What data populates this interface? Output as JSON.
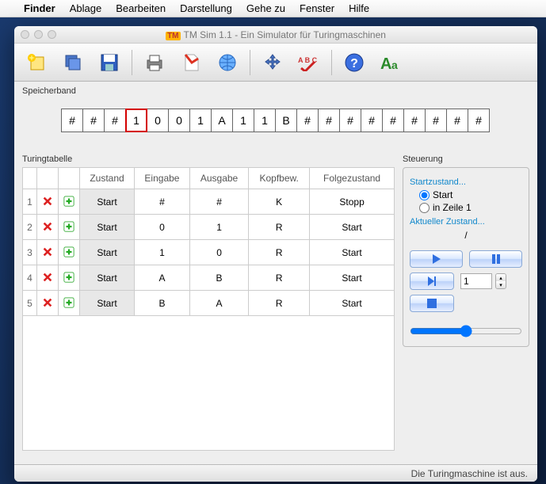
{
  "menubar": {
    "items": [
      "Finder",
      "Ablage",
      "Bearbeiten",
      "Darstellung",
      "Gehe zu",
      "Fenster",
      "Hilfe"
    ]
  },
  "window": {
    "title": "TM Sim 1.1 - Ein Simulator für Turingmaschinen",
    "badge": "TM"
  },
  "sections": {
    "tape": "Speicherband",
    "table": "Turingtabelle",
    "control": "Steuerung"
  },
  "tape": {
    "cells": [
      "#",
      "#",
      "#",
      "1",
      "0",
      "0",
      "1",
      "A",
      "1",
      "1",
      "B",
      "#",
      "#",
      "#",
      "#",
      "#",
      "#",
      "#",
      "#",
      "#"
    ],
    "head": 3
  },
  "table": {
    "headers": [
      "Zustand",
      "Eingabe",
      "Ausgabe",
      "Kopfbew.",
      "Folgezustand"
    ],
    "rows": [
      {
        "n": 1,
        "state": "Start",
        "in": "#",
        "out": "#",
        "move": "K",
        "next": "Stopp"
      },
      {
        "n": 2,
        "state": "Start",
        "in": "0",
        "out": "1",
        "move": "R",
        "next": "Start"
      },
      {
        "n": 3,
        "state": "Start",
        "in": "1",
        "out": "0",
        "move": "R",
        "next": "Start"
      },
      {
        "n": 4,
        "state": "Start",
        "in": "A",
        "out": "B",
        "move": "R",
        "next": "Start"
      },
      {
        "n": 5,
        "state": "Start",
        "in": "B",
        "out": "A",
        "move": "R",
        "next": "Start"
      }
    ]
  },
  "control": {
    "startstate_label": "Startzustand...",
    "radio_start": "Start",
    "radio_line1": "in Zeile 1",
    "current_label": "Aktueller Zustand...",
    "current_value": "/",
    "step_value": "1"
  },
  "status": "Die Turingmaschine ist aus.",
  "colors": {
    "accent": "#1166cc"
  }
}
